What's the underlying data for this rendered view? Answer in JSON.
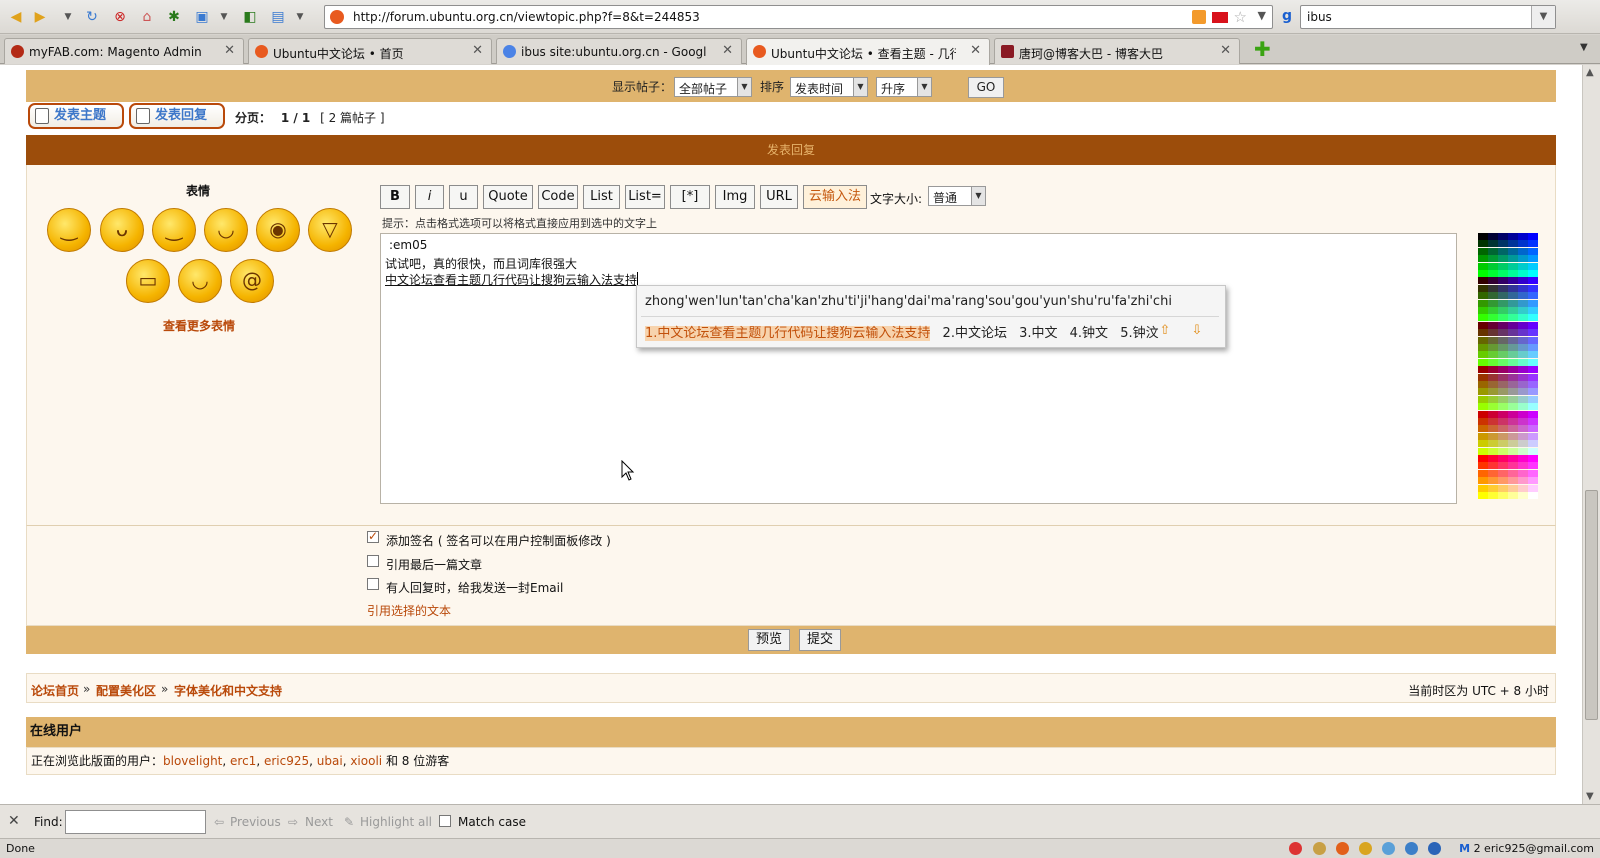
{
  "browser": {
    "url": "http://forum.ubuntu.org.cn/viewtopic.php?f=8&t=244853",
    "search_value": "ibus",
    "tabs": [
      {
        "label": "myFAB.com: Magento Admin",
        "color": "#b32a16"
      },
      {
        "label": "Ubuntu中文论坛 • 首页",
        "color": "#e85a1f"
      },
      {
        "label": "ibus site:ubuntu.org.cn - Google S...",
        "color": "#4b83e6"
      },
      {
        "label": "Ubuntu中文论坛 • 查看主题 - 几行...",
        "color": "#e85a1f"
      },
      {
        "label": "唐珂@博客大巴 - 博客大巴",
        "color": "#8a1a24"
      }
    ]
  },
  "sortbar": {
    "show_label": "显示帖子：",
    "show_value": "全部帖子",
    "sort_label": "排序",
    "sort_value": "发表时间",
    "order_value": "升序",
    "go": "GO"
  },
  "actions": {
    "new_topic": "发表主题",
    "reply": "发表回复",
    "pagination_label": "分页：",
    "pagination_value": "1 / 1",
    "post_count": "[ 2 篇帖子 ]"
  },
  "form": {
    "header": "发表回复",
    "smilies_title": "表情",
    "more_smilies": "查看更多表情",
    "toolbar": [
      "B",
      "i",
      "u",
      "Quote",
      "Code",
      "List",
      "List=",
      "[*]",
      "Img",
      "URL",
      "云输入法"
    ],
    "font_size_label": "文字大小:",
    "font_size_value": "普通",
    "hint": "提示：点击格式选项可以将格式直接应用到选中的文字上",
    "editor_lines": [
      ":em05",
      "试试吧，真的很快，而且词库很强大",
      "中文论坛查看主题几行代码让搜狗云输入法支持"
    ],
    "palette_colors": [
      "#000000",
      "#000033",
      "#000066",
      "#000099",
      "#0000cc",
      "#0000ff",
      "#003300",
      "#003333",
      "#003366",
      "#003399",
      "#0033cc",
      "#0033ff",
      "#006600",
      "#006633",
      "#006666",
      "#006699",
      "#0066cc",
      "#0066ff",
      "#009900",
      "#009933",
      "#009966",
      "#009999",
      "#0099cc",
      "#0099ff",
      "#00cc00",
      "#00cc33",
      "#00cc66",
      "#00cc99",
      "#00cccc",
      "#00ccff",
      "#00ff00",
      "#00ff33",
      "#00ff66",
      "#00ff99",
      "#00ffcc",
      "#00ffff",
      "#330000",
      "#330033",
      "#330066",
      "#330099",
      "#3300cc",
      "#3300ff",
      "#333300",
      "#333333",
      "#333366",
      "#333399",
      "#3333cc",
      "#3333ff",
      "#336600",
      "#336633",
      "#336666",
      "#336699",
      "#3366cc",
      "#3366ff",
      "#339900",
      "#339933",
      "#339966",
      "#339999",
      "#3399cc",
      "#3399ff",
      "#33cc00",
      "#33cc33",
      "#33cc66",
      "#33cc99",
      "#33cccc",
      "#33ccff",
      "#33ff00",
      "#33ff33",
      "#33ff66",
      "#33ff99",
      "#33ffcc",
      "#33ffff",
      "#660000",
      "#660033",
      "#660066",
      "#660099",
      "#6600cc",
      "#6600ff",
      "#663300",
      "#663333",
      "#663366",
      "#663399",
      "#6633cc",
      "#6633ff",
      "#666600",
      "#666633",
      "#666666",
      "#666699",
      "#6666cc",
      "#6666ff",
      "#669900",
      "#669933",
      "#669966",
      "#669999",
      "#6699cc",
      "#6699ff",
      "#66cc00",
      "#66cc33",
      "#66cc66",
      "#66cc99",
      "#66cccc",
      "#66ccff",
      "#66ff00",
      "#66ff33",
      "#66ff66",
      "#66ff99",
      "#66ffcc",
      "#66ffff",
      "#990000",
      "#990033",
      "#990066",
      "#990099",
      "#9900cc",
      "#9900ff",
      "#993300",
      "#993333",
      "#993366",
      "#993399",
      "#9933cc",
      "#9933ff",
      "#996600",
      "#996633",
      "#996666",
      "#996699",
      "#9966cc",
      "#9966ff",
      "#999900",
      "#999933",
      "#999966",
      "#999999",
      "#9999cc",
      "#9999ff",
      "#99cc00",
      "#99cc33",
      "#99cc66",
      "#99cc99",
      "#99cccc",
      "#99ccff",
      "#99ff00",
      "#99ff33",
      "#99ff66",
      "#99ff99",
      "#99ffcc",
      "#99ffff",
      "#cc0000",
      "#cc0033",
      "#cc0066",
      "#cc0099",
      "#cc00cc",
      "#cc00ff",
      "#cc3300",
      "#cc3333",
      "#cc3366",
      "#cc3399",
      "#cc33cc",
      "#cc33ff",
      "#cc6600",
      "#cc6633",
      "#cc6666",
      "#cc6699",
      "#cc66cc",
      "#cc66ff",
      "#cc9900",
      "#cc9933",
      "#cc9966",
      "#cc9999",
      "#cc99cc",
      "#cc99ff",
      "#cccc00",
      "#cccc33",
      "#cccc66",
      "#cccc99",
      "#cccccc",
      "#ccccff",
      "#ccff00",
      "#ccff33",
      "#ccff66",
      "#ccff99",
      "#ccffcc",
      "#ccffff",
      "#ff0000",
      "#ff0033",
      "#ff0066",
      "#ff0099",
      "#ff00cc",
      "#ff00ff",
      "#ff3300",
      "#ff3333",
      "#ff3366",
      "#ff3399",
      "#ff33cc",
      "#ff33ff",
      "#ff6600",
      "#ff6633",
      "#ff6666",
      "#ff6699",
      "#ff66cc",
      "#ff66ff",
      "#ff9900",
      "#ff9933",
      "#ff9966",
      "#ff9999",
      "#ff99cc",
      "#ff99ff",
      "#ffcc00",
      "#ffcc33",
      "#ffcc66",
      "#ffcc99",
      "#ffcccc",
      "#ffccff",
      "#ffff00",
      "#ffff33",
      "#ffff66",
      "#ffff99",
      "#ffffcc",
      "#ffffff"
    ]
  },
  "ime": {
    "pinyin": "zhong'wen'lun'tan'cha'kan'zhu'ti'ji'hang'dai'ma'rang'sou'gou'yun'shu'ru'fa'zhi'chi",
    "candidates": [
      "1.中文论坛查看主题几行代码让搜狗云输入法支持",
      "2.中文论坛",
      "3.中文",
      "4.钟文",
      "5.钟汶"
    ]
  },
  "options": {
    "signature": "添加签名 ( 签名可以在用户控制面板修改 )",
    "quote_last": "引用最后一篇文章",
    "notify": "有人回复时，给我发送一封Email",
    "quote_selected": "引用选择的文本",
    "preview": "预览",
    "submit": "提交"
  },
  "breadcrumbs": {
    "home": "论坛首页",
    "section": "配置美化区",
    "forum": "字体美化和中文支持",
    "timezone": "当前时区为 UTC + 8 小时"
  },
  "online": {
    "title": "在线用户",
    "prefix": "正在浏览此版面的用户：",
    "users": [
      "blovelight",
      "erc1",
      "eric925",
      "ubai",
      "xiooli"
    ],
    "suffix": "和 8 位游客"
  },
  "findbar": {
    "label": "Find:",
    "previous": "Previous",
    "next": "Next",
    "highlight": "Highlight all",
    "match_case": "Match case"
  },
  "status": {
    "text": "Done",
    "mail": "2 eric925@gmail.com"
  }
}
